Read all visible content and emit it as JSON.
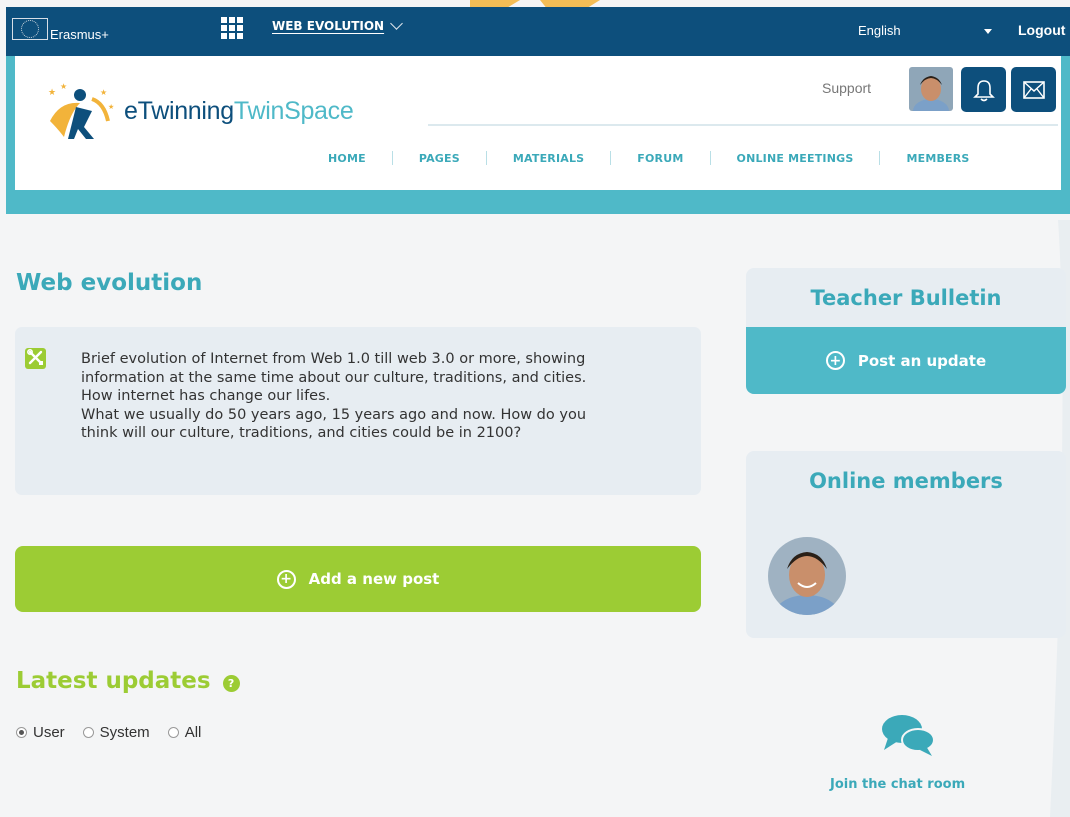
{
  "topbar": {
    "program": "Erasmus+",
    "project_menu": "WEB EVOLUTION",
    "language": "English",
    "logout": "Logout"
  },
  "header": {
    "logo_prefix": "eTwinning",
    "logo_suffix": "TwinSpace",
    "support": "Support"
  },
  "nav": {
    "items": [
      "HOME",
      "PAGES",
      "MATERIALS",
      "FORUM",
      "ONLINE MEETINGS",
      "MEMBERS"
    ]
  },
  "main": {
    "title": "Web evolution",
    "description_lines": [
      "Brief evolution of Internet from Web 1.0 till web 3.0 or more, showing",
      "information at the same time about our culture, traditions, and cities.",
      "How internet has change our lifes.",
      "What we usually do 50 years ago, 15 years ago and now. How do you",
      "think will our culture, traditions, and cities could be in 2100?"
    ],
    "add_post": "Add a new post",
    "latest_title": "Latest updates",
    "filters": [
      "User",
      "System",
      "All"
    ],
    "selected_filter": "User"
  },
  "sidebar": {
    "bulletin_title": "Teacher Bulletin",
    "post_update": "Post an update",
    "members_title": "Online members",
    "chat_label": "Join the chat room"
  },
  "colors": {
    "dark_blue": "#0d4f7c",
    "teal": "#4fb9c8",
    "teal_text": "#3ba9b9",
    "green": "#9ccc34",
    "panel": "#e7edf2"
  }
}
